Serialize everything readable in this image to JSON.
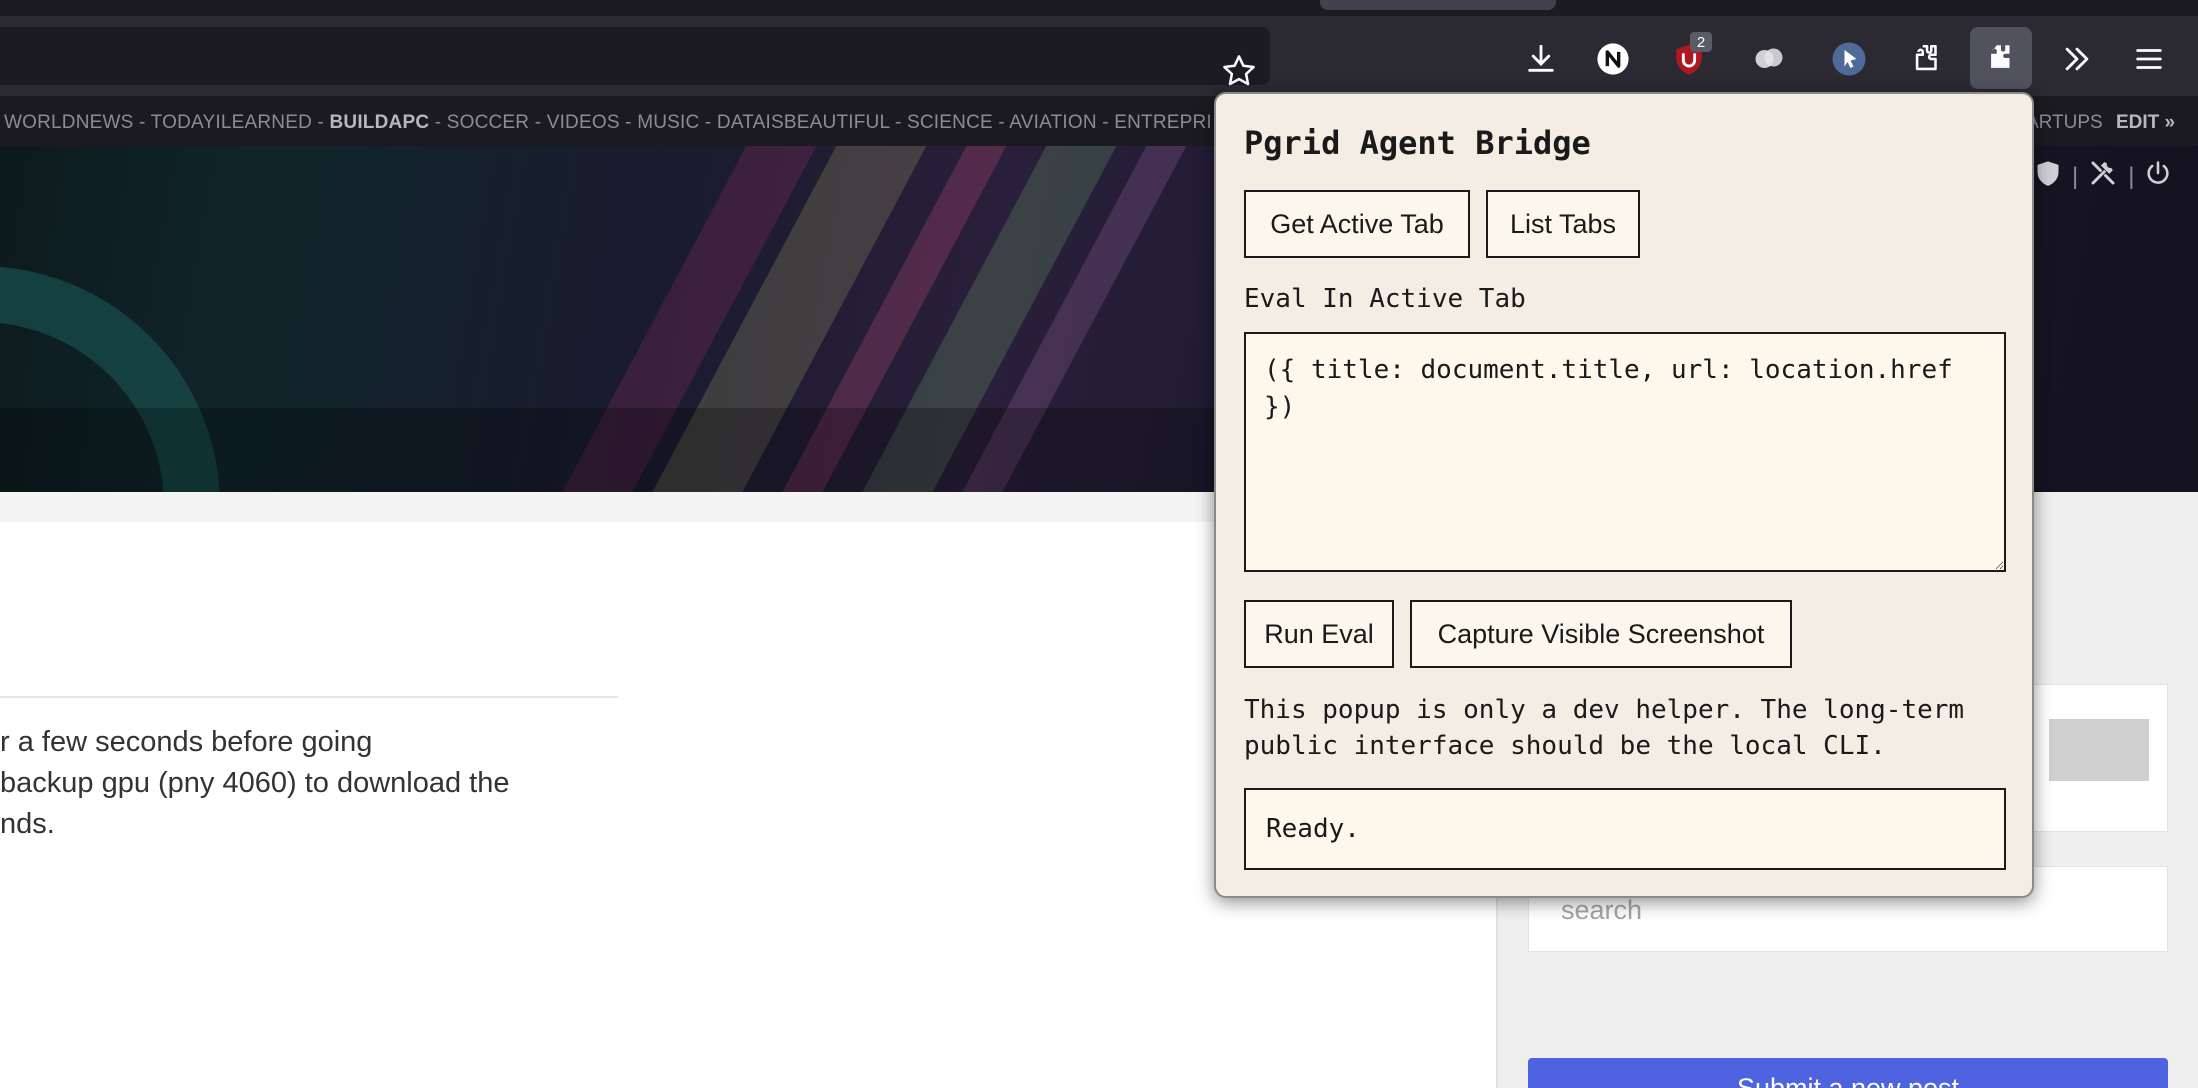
{
  "subnav": {
    "left_before": "WORLDNEWS - TODAYILEARNED - ",
    "left_bold": "BUILDAPC",
    "left_after": " - SOCCER - VIDEOS - MUSIC - DATAISBEAUTIFUL - SCIENCE - AVIATION - ENTREPRI",
    "right": "ARTUPS",
    "edit": "EDIT »"
  },
  "toolbar": {
    "badge_count": "2",
    "icons": [
      "star-icon",
      "download-icon",
      "n-extension-icon",
      "ublock-icon",
      "cloud-extension-icon",
      "cursor-extension-icon",
      "extensions-puzzle-icon",
      "puzzle-active-icon",
      "overflow-chevrons-icon",
      "menu-hamburger-icon"
    ]
  },
  "page": {
    "post_lines": [
      "r a few seconds before going",
      " backup gpu (pny 4060) to download the",
      "nds."
    ],
    "search_placeholder": "search",
    "submit_label": "Submit a new post"
  },
  "popup": {
    "title": "Pgrid Agent Bridge",
    "get_active_tab_label": "Get Active Tab",
    "list_tabs_label": "List Tabs",
    "eval_label": "Eval In Active Tab",
    "eval_value": "({ title: document.title, url: location.href })",
    "run_eval_label": "Run Eval",
    "capture_label": "Capture Visible Screenshot",
    "helper_text": "This popup is only a dev helper. The long-term public interface should be the local CLI.",
    "status": "Ready."
  },
  "colors": {
    "chrome_dark": "#2b2a33",
    "popup_bg": "#f3ede3",
    "submit_blue": "#4f63e0"
  }
}
